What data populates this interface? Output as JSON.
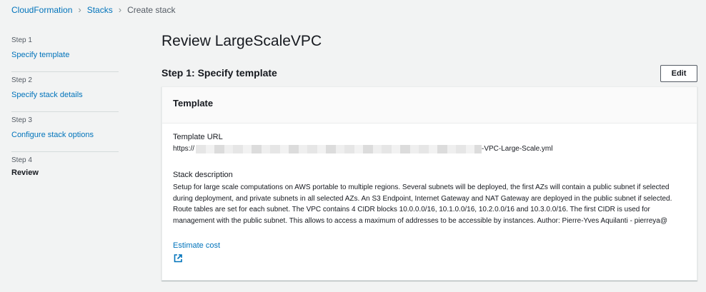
{
  "breadcrumb": {
    "items": [
      "CloudFormation",
      "Stacks"
    ],
    "current": "Create stack"
  },
  "steps": [
    {
      "num": "Step 1",
      "label": "Specify template"
    },
    {
      "num": "Step 2",
      "label": "Specify stack details"
    },
    {
      "num": "Step 3",
      "label": "Configure stack options"
    },
    {
      "num": "Step 4",
      "label": "Review"
    }
  ],
  "page": {
    "title": "Review LargeScaleVPC",
    "section_title": "Step 1: Specify template",
    "edit_label": "Edit"
  },
  "panel": {
    "header": "Template",
    "template_url_label": "Template URL",
    "template_url_prefix": "https://",
    "template_url_suffix": "-VPC-Large-Scale.yml",
    "description_label": "Stack description",
    "description": "Setup for large scale computations on AWS portable to multiple regions. Several subnets will be deployed, the first AZs will contain a public subnet if selected during deployment, and private subnets in all selected AZs. An S3 Endpoint, Internet Gateway and NAT Gateway are deployed in the public subnet if selected. Route tables are set for each subnet. The VPC contains 4 CIDR blocks 10.0.0.0/16, 10.1.0.0/16, 10.2.0.0/16 and 10.3.0.0/16. The first CIDR is used for management with the public subnet. This allows to access a maximum of addresses to be accessible by instances. Author: Pierre-Yves Aquilanti - pierreya@",
    "estimate_cost_label": "Estimate cost"
  },
  "colors": {
    "link": "#0073bb",
    "background": "#f2f3f3"
  }
}
